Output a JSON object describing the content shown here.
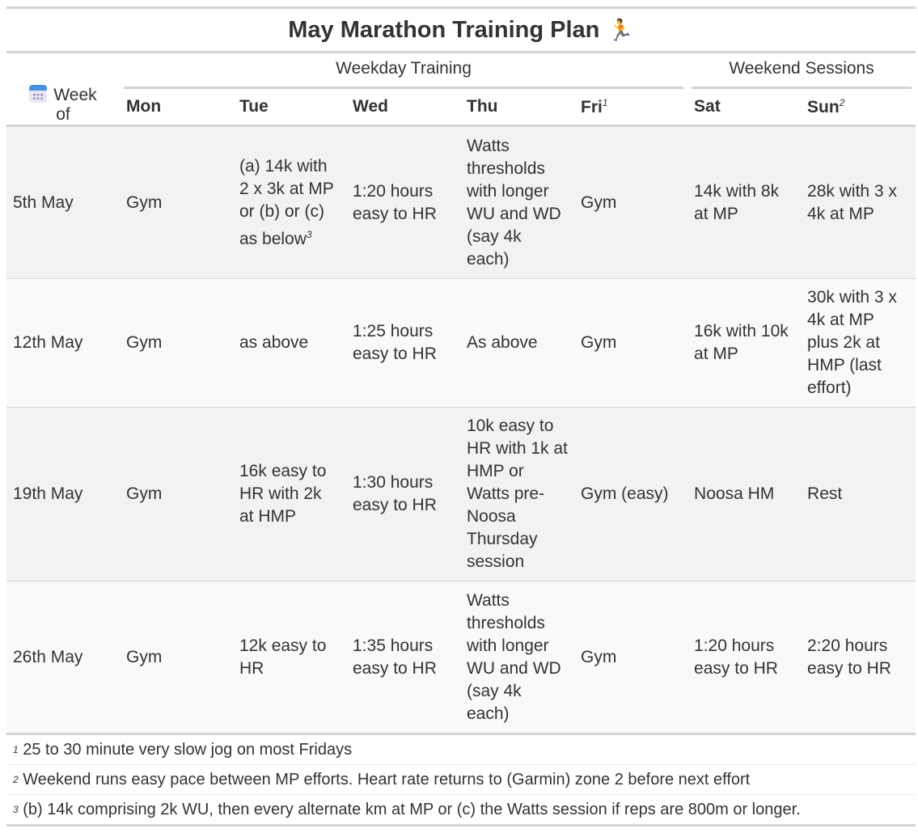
{
  "title": "May Marathon Training Plan",
  "title_emoji": "🏃",
  "stub_label_line1": "Week",
  "stub_label_line2": "of",
  "spanners": {
    "weekday": "Weekday Training",
    "weekend": "Weekend Sessions"
  },
  "columns": {
    "mon": "Mon",
    "tue": "Tue",
    "wed": "Wed",
    "thu": "Thu",
    "fri": "Fri",
    "fri_mark": "1",
    "sat": "Sat",
    "sun": "Sun",
    "sun_mark": "2"
  },
  "rows": [
    {
      "week": "5th May",
      "mon": "Gym",
      "tue": "(a) 14k with 2 x 3k at MP or (b) or (c) as below",
      "tue_mark": "3",
      "wed": "1:20 hours easy to HR",
      "thu": "Watts thresholds with longer WU and WD (say 4k each)",
      "fri": "Gym",
      "sat": "14k with 8k at MP",
      "sun": "28k with 3 x 4k at MP"
    },
    {
      "week": "12th May",
      "mon": "Gym",
      "tue": "as above",
      "wed": "1:25 hours easy to HR",
      "thu": "As above",
      "fri": "Gym",
      "sat": "16k with 10k at MP",
      "sun": "30k with 3 x 4k at MP plus 2k at HMP (last effort)"
    },
    {
      "week": "19th May",
      "mon": "Gym",
      "tue": "16k easy to HR with 2k at HMP",
      "wed": "1:30 hours easy to HR",
      "thu": "10k easy to HR with 1k at HMP or Watts pre-Noosa Thursday session",
      "fri": "Gym (easy)",
      "sat": "Noosa HM",
      "sun": "Rest"
    },
    {
      "week": "26th May",
      "mon": "Gym",
      "tue": "12k easy to HR",
      "wed": "1:35 hours easy to HR",
      "thu": "Watts thresholds with longer WU and WD (say 4k each)",
      "fri": "Gym",
      "sat": "1:20 hours easy to HR",
      "sun": "2:20 hours easy to HR"
    }
  ],
  "footnotes": [
    {
      "mark": "1",
      "text": "25 to 30 minute very slow jog on most Fridays"
    },
    {
      "mark": "2",
      "text": "Weekend runs easy pace between MP efforts. Heart rate returns to (Garmin) zone 2 before next effort"
    },
    {
      "mark": "3",
      "text": "(b) 14k comprising 2k WU, then every alternate km at MP or (c) the Watts session if reps are 800m or longer."
    }
  ],
  "colors": {
    "rule": "#d3d3d3",
    "stripe_odd": "#f2f2f2",
    "stripe_even": "#f9f9f9",
    "text": "#333333"
  },
  "icons": {
    "stub": "calendar-icon",
    "title": "runner-emoji"
  }
}
